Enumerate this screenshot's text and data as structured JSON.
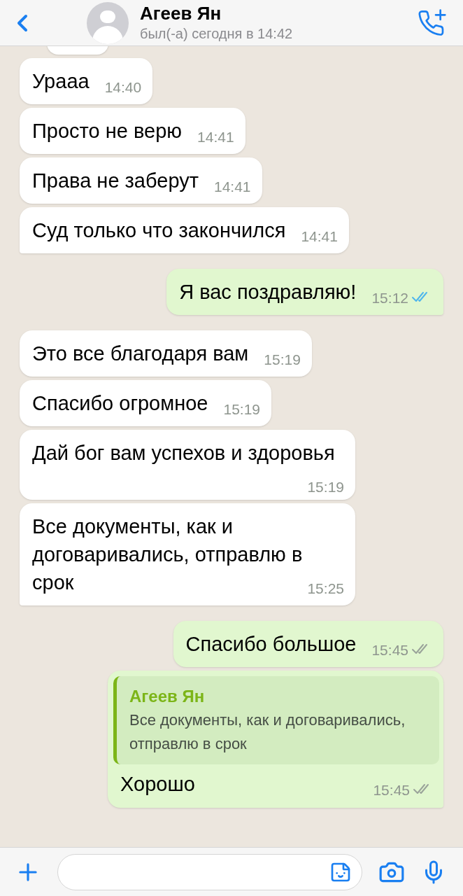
{
  "header": {
    "name": "Агеев Ян",
    "status": "был(-а) сегодня в 14:42"
  },
  "messages": [
    {
      "kind": "cut_off",
      "outgoing": false
    },
    {
      "kind": "message",
      "outgoing": false,
      "text": "Урааа",
      "time": "14:40"
    },
    {
      "kind": "message",
      "outgoing": false,
      "text": "Просто не верю",
      "time": "14:41"
    },
    {
      "kind": "message",
      "outgoing": false,
      "text": "Права не заберут",
      "time": "14:41"
    },
    {
      "kind": "message",
      "outgoing": false,
      "text": "Суд только что закончился",
      "time": "14:41"
    },
    {
      "kind": "message",
      "outgoing": true,
      "text": "Я вас поздравляю!",
      "time": "15:12",
      "read": true
    },
    {
      "kind": "message",
      "outgoing": false,
      "text": "Это все благодаря вам",
      "time": "15:19"
    },
    {
      "kind": "message",
      "outgoing": false,
      "text": "Спасибо огромное",
      "time": "15:19"
    },
    {
      "kind": "message",
      "outgoing": false,
      "text": "Дай бог вам успехов и здоровья",
      "time": "15:19"
    },
    {
      "kind": "message",
      "outgoing": false,
      "text": "Все документы, как и договаривались, отправлю в срок",
      "time": "15:25"
    },
    {
      "kind": "message",
      "outgoing": true,
      "text": "Спасибо большое",
      "time": "15:45",
      "read": false
    },
    {
      "kind": "message",
      "outgoing": true,
      "reply": {
        "author": "Агеев Ян",
        "text": "Все документы, как и договаривались, отправлю в срок"
      },
      "text": "Хорошо",
      "time": "15:45",
      "read": false
    }
  ]
}
